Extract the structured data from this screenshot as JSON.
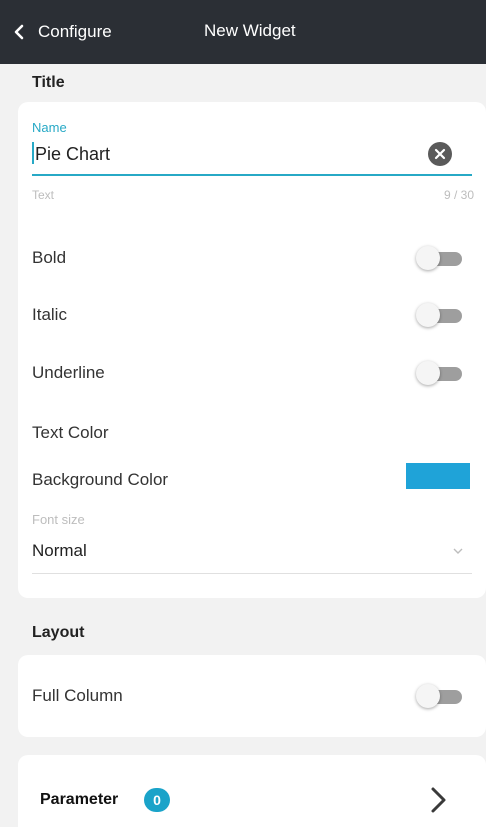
{
  "header": {
    "back_label": "Configure",
    "title": "New Widget"
  },
  "title_section": {
    "heading": "Title",
    "name_field": {
      "label": "Name",
      "value": "Pie Chart",
      "helper": "Text",
      "counter": "9 / 30"
    },
    "toggles": [
      {
        "label": "Bold",
        "on": false
      },
      {
        "label": "Italic",
        "on": false
      },
      {
        "label": "Underline",
        "on": false
      }
    ],
    "text_color_label": "Text Color",
    "background_color_label": "Background Color",
    "background_color": "#1fa3d8",
    "font_size": {
      "label": "Font size",
      "value": "Normal"
    }
  },
  "layout_section": {
    "heading": "Layout",
    "full_column": {
      "label": "Full Column",
      "on": false
    }
  },
  "parameter_section": {
    "label": "Parameter",
    "count": "0"
  },
  "colors": {
    "accent": "#27a9c6",
    "header_bg": "#2b2f35",
    "badge": "#1aa3c9"
  },
  "icons": [
    "back-chevron-icon",
    "clear-icon",
    "chevron-down-icon",
    "chevron-right-icon"
  ]
}
